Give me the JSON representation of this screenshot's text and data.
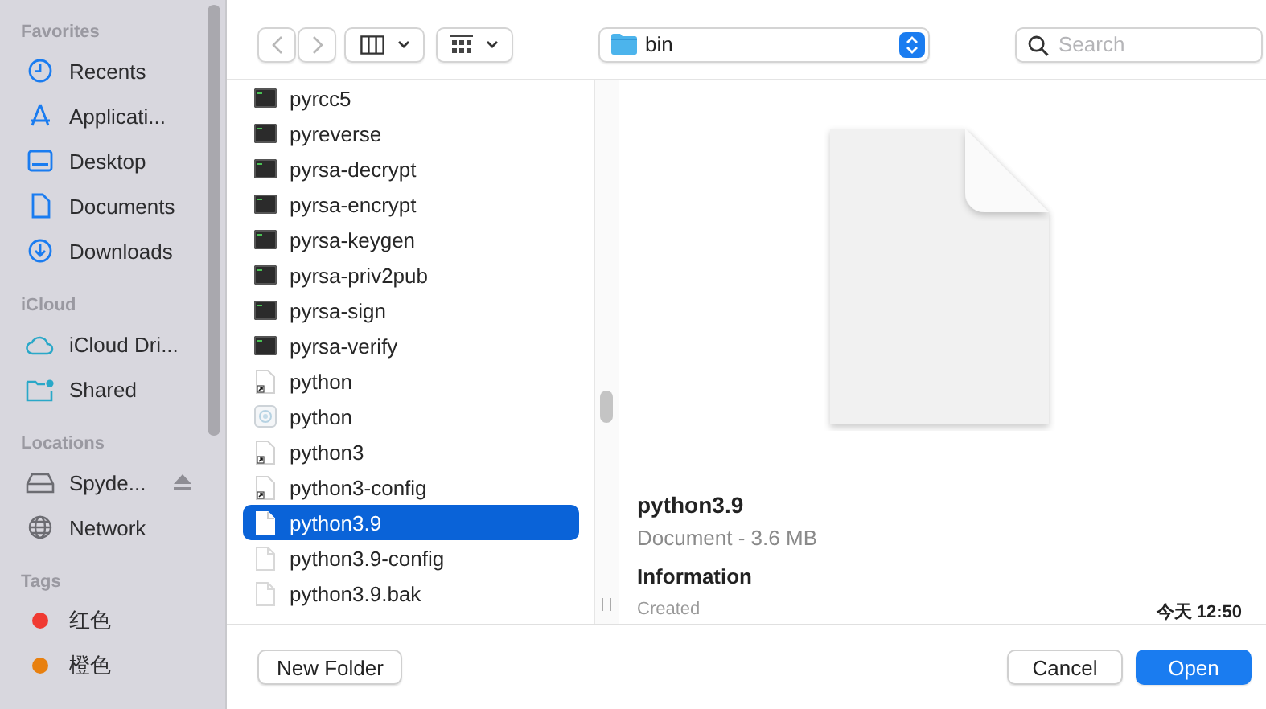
{
  "sidebar": {
    "sections": [
      {
        "title": "Favorites",
        "items": [
          {
            "label": "Recents",
            "kind": "clock"
          },
          {
            "label": "Applicati...",
            "kind": "apps"
          },
          {
            "label": "Desktop",
            "kind": "desktop"
          },
          {
            "label": "Documents",
            "kind": "document"
          },
          {
            "label": "Downloads",
            "kind": "download"
          }
        ]
      },
      {
        "title": "iCloud",
        "items": [
          {
            "label": "iCloud Dri...",
            "kind": "cloud"
          },
          {
            "label": "Shared",
            "kind": "shared"
          }
        ]
      },
      {
        "title": "Locations",
        "items": [
          {
            "label": "Spyde...",
            "kind": "drive"
          },
          {
            "label": "Network",
            "kind": "globe"
          }
        ]
      },
      {
        "title": "Tags",
        "items": [
          {
            "label": "红色",
            "kind": "tag",
            "color": "#f03a32"
          },
          {
            "label": "橙色",
            "kind": "tag",
            "color": "#e8800f"
          }
        ]
      }
    ]
  },
  "toolbar": {
    "path": "bin",
    "search": {
      "placeholder": "Search"
    }
  },
  "files": [
    {
      "name": "pyrcc5",
      "kind": "exec",
      "selected": false
    },
    {
      "name": "pyreverse",
      "kind": "exec",
      "selected": false
    },
    {
      "name": "pyrsa-decrypt",
      "kind": "exec",
      "selected": false
    },
    {
      "name": "pyrsa-encrypt",
      "kind": "exec",
      "selected": false
    },
    {
      "name": "pyrsa-keygen",
      "kind": "exec",
      "selected": false
    },
    {
      "name": "pyrsa-priv2pub",
      "kind": "exec",
      "selected": false
    },
    {
      "name": "pyrsa-sign",
      "kind": "exec",
      "selected": false
    },
    {
      "name": "pyrsa-verify",
      "kind": "exec",
      "selected": false
    },
    {
      "name": "python",
      "kind": "alias",
      "selected": false
    },
    {
      "name": "python",
      "kind": "app",
      "selected": false
    },
    {
      "name": "python3",
      "kind": "alias",
      "selected": false
    },
    {
      "name": "python3-config",
      "kind": "alias",
      "selected": false
    },
    {
      "name": "python3.9",
      "kind": "doc",
      "selected": true
    },
    {
      "name": "python3.9-config",
      "kind": "doc",
      "selected": false
    },
    {
      "name": "python3.9.bak",
      "kind": "doc",
      "selected": false
    }
  ],
  "preview": {
    "name": "python3.9",
    "summary": "Document - 3.6 MB",
    "info_heading": "Information",
    "details": [
      {
        "label": "Created",
        "value": "今天 12:50"
      }
    ]
  },
  "footer": {
    "new_folder": "New Folder",
    "cancel": "Cancel",
    "open": "Open"
  }
}
